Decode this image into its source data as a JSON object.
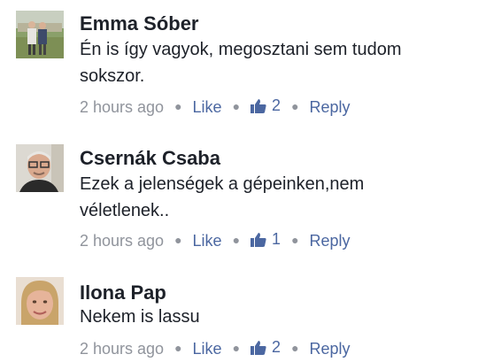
{
  "comments": [
    {
      "author": "Emma Sóber",
      "text": "Én is így vagyok, megosztani sem tudom sokszor.",
      "time": "2 hours ago",
      "like_label": "Like",
      "likes": "2",
      "reply_label": "Reply",
      "avatar": "outdoor-couple-photo"
    },
    {
      "author": "Csernák Csaba",
      "text": "Ezek a jelenségek a gépeinken,nem véletlenek..",
      "time": "2 hours ago",
      "like_label": "Like",
      "likes": "1",
      "reply_label": "Reply",
      "avatar": "man-portrait-photo"
    },
    {
      "author": "Ilona Pap",
      "text": "Nekem is lassu",
      "time": "2 hours ago",
      "like_label": "Like",
      "likes": "2",
      "reply_label": "Reply",
      "avatar": "woman-portrait-photo"
    }
  ],
  "colors": {
    "name": "#1d2129",
    "meta": "#90949c",
    "link": "#4b67a1"
  }
}
